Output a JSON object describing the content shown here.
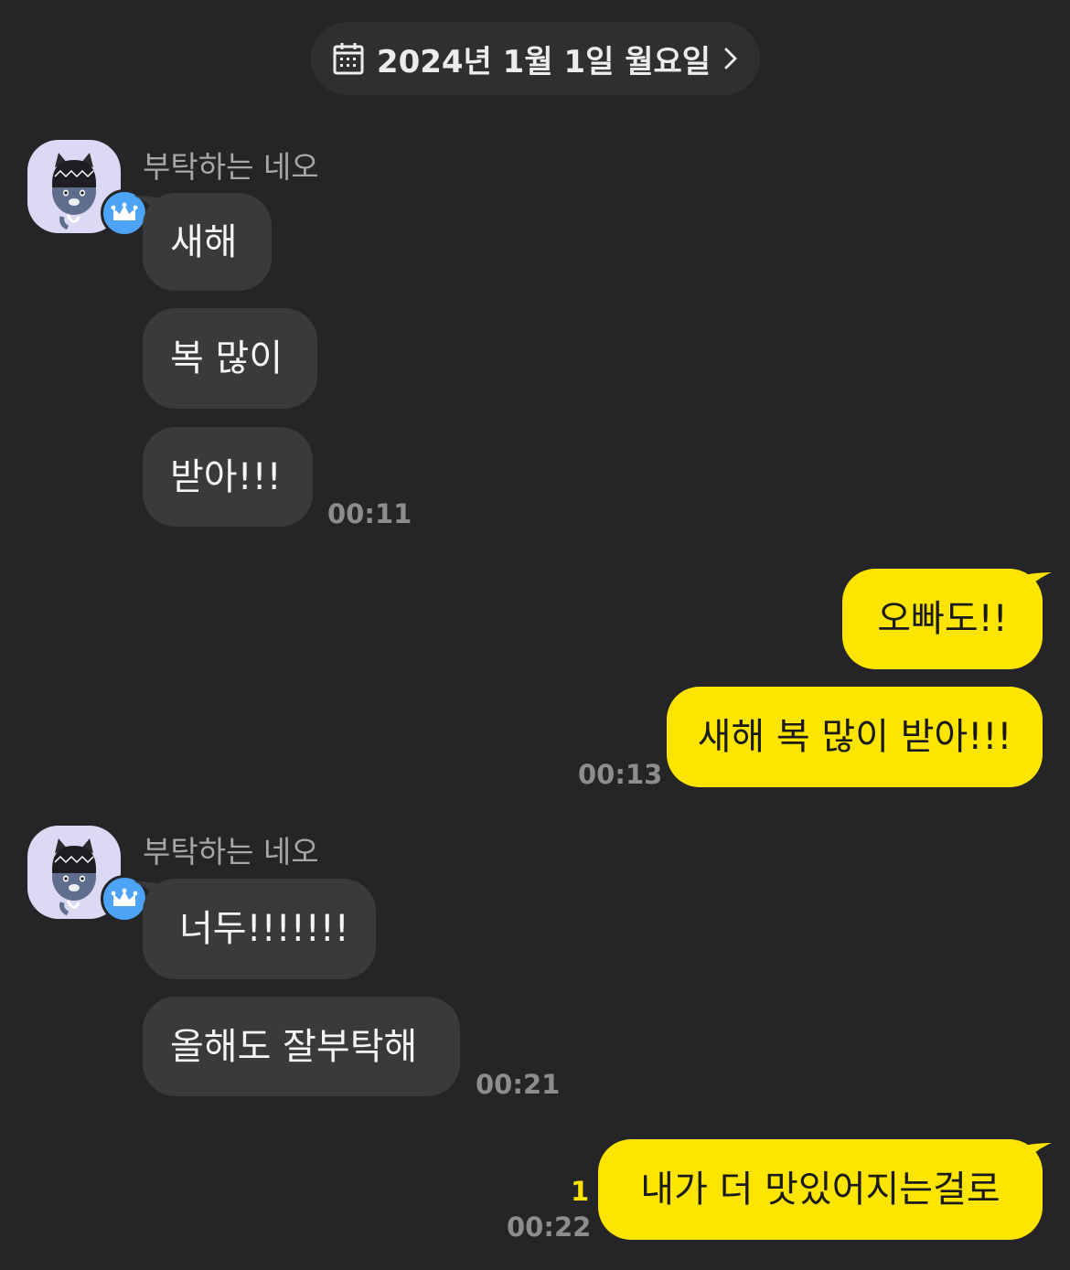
{
  "date_divider": {
    "label": "2024년 1월 1일 월요일",
    "icon": "calendar-icon",
    "chevron": "chevron-right-icon"
  },
  "colors": {
    "background": "#252528",
    "incoming_bubble": "#3a3a3d",
    "outgoing_bubble": "#fee500",
    "unread_count": "#fee500",
    "avatar_bg": "#dcd9f4",
    "crown_badge": "#4da3f5"
  },
  "groups": [
    {
      "sender": "부탁하는 네오",
      "avatar_icon": "neo-character-avatar",
      "badge_icon": "crown-icon",
      "messages": [
        "새해",
        "복 많이",
        "받아!!!"
      ],
      "time": "00:11"
    },
    {
      "sender": "",
      "messages": [
        "오빠도!!",
        "새해 복 많이 받아!!!"
      ],
      "time": "00:13"
    },
    {
      "sender": "부탁하는 네오",
      "avatar_icon": "neo-character-avatar",
      "badge_icon": "crown-icon",
      "messages": [
        "너두!!!!!!!",
        "올해도 잘부탁해"
      ],
      "time": "00:21"
    },
    {
      "sender": "",
      "messages": [
        "내가 더 맛있어지는걸로"
      ],
      "time": "00:22",
      "unread": "1"
    }
  ]
}
